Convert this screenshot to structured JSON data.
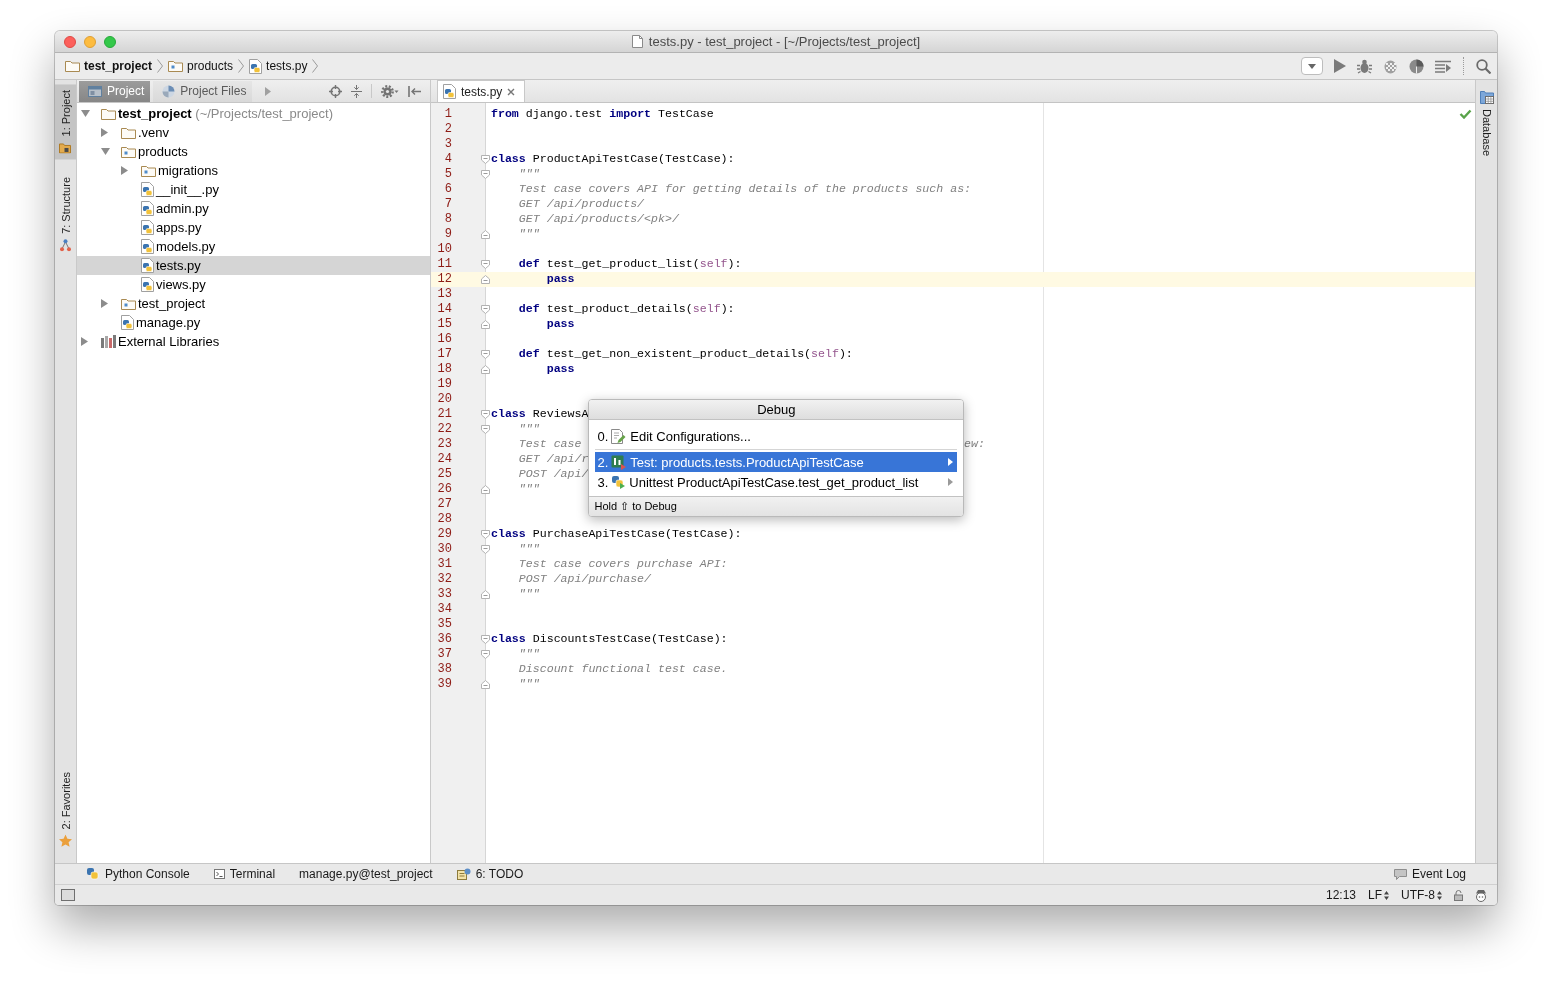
{
  "window": {
    "title": "tests.py - test_project - [~/Projects/test_project]"
  },
  "breadcrumbs": [
    {
      "label": "test_project",
      "kind": "project"
    },
    {
      "label": "products",
      "kind": "module"
    },
    {
      "label": "tests.py",
      "kind": "script"
    }
  ],
  "left_tool_tabs": {
    "top": [
      {
        "label": "1: Project",
        "kind": "project",
        "selected": true
      },
      {
        "label": "7: Structure",
        "kind": "structure",
        "selected": false
      }
    ],
    "bottom": [
      {
        "label": "2: Favorites",
        "kind": "favorites",
        "selected": false
      }
    ]
  },
  "project_panel": {
    "tabs": [
      {
        "label": "Project",
        "kind": "project",
        "selected": true
      },
      {
        "label": "Project Files",
        "kind": "files",
        "selected": false
      }
    ],
    "tree": [
      {
        "label": "test_project",
        "hint": "(~/Projects/test_project)",
        "kind": "project",
        "expanded": true,
        "selected": false,
        "children": [
          {
            "label": ".venv",
            "kind": "folder",
            "expanded": false,
            "selected": false
          },
          {
            "label": "products",
            "kind": "module",
            "expanded": true,
            "selected": false,
            "children": [
              {
                "label": "migrations",
                "kind": "module",
                "expanded": false,
                "selected": false
              },
              {
                "label": "__init__.py",
                "kind": "script",
                "selected": false
              },
              {
                "label": "admin.py",
                "kind": "script",
                "selected": false
              },
              {
                "label": "apps.py",
                "kind": "script",
                "selected": false
              },
              {
                "label": "models.py",
                "kind": "script",
                "selected": false
              },
              {
                "label": "tests.py",
                "kind": "script",
                "selected": true
              },
              {
                "label": "views.py",
                "kind": "script",
                "selected": false
              }
            ]
          },
          {
            "label": "test_project",
            "kind": "module",
            "expanded": false,
            "selected": false
          },
          {
            "label": "manage.py",
            "kind": "script",
            "selected": false
          }
        ]
      },
      {
        "label": "External Libraries",
        "kind": "library",
        "expanded": false,
        "selected": false
      }
    ]
  },
  "editor": {
    "tabs": [
      {
        "label": "tests.py",
        "selected": true
      }
    ],
    "lines": [
      {
        "number": "1",
        "kind": "plain",
        "tokens": [
          {
            "kind": "keyword",
            "text": "from"
          },
          {
            "kind": "plain",
            "text": " django.test "
          },
          {
            "kind": "keyword",
            "text": "import"
          },
          {
            "kind": "plain",
            "text": " TestCase"
          }
        ]
      },
      {
        "number": "2",
        "kind": "plain"
      },
      {
        "number": "3",
        "kind": "plain"
      },
      {
        "number": "4",
        "kind": "opening",
        "tokens": [
          {
            "kind": "keyword",
            "text": "class"
          },
          {
            "kind": "plain",
            "text": " ProductApiTestCase(TestCase):"
          }
        ]
      },
      {
        "number": "5",
        "kind": "opening",
        "tokens": [
          {
            "kind": "docstring",
            "text": "    \"\"\""
          }
        ]
      },
      {
        "number": "6",
        "kind": "plain",
        "tokens": [
          {
            "kind": "docstring",
            "text": "    Test case covers API for getting details of the products such as:"
          }
        ]
      },
      {
        "number": "7",
        "kind": "plain",
        "tokens": [
          {
            "kind": "docstring",
            "text": "    GET /api/products/"
          }
        ]
      },
      {
        "number": "8",
        "kind": "plain",
        "tokens": [
          {
            "kind": "docstring",
            "text": "    GET /api/products/<pk>/"
          }
        ]
      },
      {
        "number": "9",
        "kind": "closing",
        "tokens": [
          {
            "kind": "docstring",
            "text": "    \"\"\""
          }
        ]
      },
      {
        "number": "10",
        "kind": "plain"
      },
      {
        "number": "11",
        "kind": "opening",
        "tokens": [
          {
            "kind": "keyword",
            "text": "    def"
          },
          {
            "kind": "plain",
            "text": " test_get_product_list("
          },
          {
            "kind": "self",
            "text": "self"
          },
          {
            "kind": "plain",
            "text": "):"
          }
        ]
      },
      {
        "number": "12",
        "kind": "closing",
        "current": true,
        "tokens": [
          {
            "kind": "keyword",
            "text": "        pass"
          }
        ]
      },
      {
        "number": "13",
        "kind": "plain"
      },
      {
        "number": "14",
        "kind": "opening",
        "tokens": [
          {
            "kind": "keyword",
            "text": "    def"
          },
          {
            "kind": "plain",
            "text": " test_product_details("
          },
          {
            "kind": "self",
            "text": "self"
          },
          {
            "kind": "plain",
            "text": "):"
          }
        ]
      },
      {
        "number": "15",
        "kind": "closing",
        "tokens": [
          {
            "kind": "keyword",
            "text": "        pass"
          }
        ]
      },
      {
        "number": "16",
        "kind": "plain"
      },
      {
        "number": "17",
        "kind": "opening",
        "tokens": [
          {
            "kind": "keyword",
            "text": "    def"
          },
          {
            "kind": "plain",
            "text": " test_get_non_existent_product_details("
          },
          {
            "kind": "self",
            "text": "self"
          },
          {
            "kind": "plain",
            "text": "):"
          }
        ]
      },
      {
        "number": "18",
        "kind": "closing",
        "tokens": [
          {
            "kind": "keyword",
            "text": "        pass"
          }
        ]
      },
      {
        "number": "19",
        "kind": "plain"
      },
      {
        "number": "20",
        "kind": "plain"
      },
      {
        "number": "21",
        "kind": "opening",
        "tokens": [
          {
            "kind": "keyword",
            "text": "class"
          },
          {
            "kind": "plain",
            "text": " ReviewsA"
          }
        ]
      },
      {
        "number": "22",
        "kind": "opening",
        "tokens": [
          {
            "kind": "docstring",
            "text": "    \"\"\""
          }
        ]
      },
      {
        "number": "23",
        "kind": "plain",
        "tokens": [
          {
            "kind": "docstring",
            "text": "    Test case"
          }
        ],
        "tail": [
          {
            "kind": "docstring",
            "text": "ew:"
          }
        ]
      },
      {
        "number": "24",
        "kind": "plain",
        "tokens": [
          {
            "kind": "docstring",
            "text": "    GET /api/r"
          }
        ]
      },
      {
        "number": "25",
        "kind": "plain",
        "tokens": [
          {
            "kind": "docstring",
            "text": "    POST /api/"
          }
        ]
      },
      {
        "number": "26",
        "kind": "closing",
        "tokens": [
          {
            "kind": "docstring",
            "text": "    \"\"\""
          }
        ]
      },
      {
        "number": "27",
        "kind": "plain"
      },
      {
        "number": "28",
        "kind": "plain"
      },
      {
        "number": "29",
        "kind": "opening",
        "tokens": [
          {
            "kind": "keyword",
            "text": "class"
          },
          {
            "kind": "plain",
            "text": " PurchaseApiTestCase(TestCase):"
          }
        ]
      },
      {
        "number": "30",
        "kind": "opening",
        "tokens": [
          {
            "kind": "docstring",
            "text": "    \"\"\""
          }
        ]
      },
      {
        "number": "31",
        "kind": "plain",
        "tokens": [
          {
            "kind": "docstring",
            "text": "    Test case covers purchase API:"
          }
        ]
      },
      {
        "number": "32",
        "kind": "plain",
        "tokens": [
          {
            "kind": "docstring",
            "text": "    POST /api/purchase/"
          }
        ]
      },
      {
        "number": "33",
        "kind": "closing",
        "tokens": [
          {
            "kind": "docstring",
            "text": "    \"\"\""
          }
        ]
      },
      {
        "number": "34",
        "kind": "plain"
      },
      {
        "number": "35",
        "kind": "plain"
      },
      {
        "number": "36",
        "kind": "opening",
        "tokens": [
          {
            "kind": "keyword",
            "text": "class"
          },
          {
            "kind": "plain",
            "text": " DiscountsTestCase(TestCase):"
          }
        ]
      },
      {
        "number": "37",
        "kind": "opening",
        "tokens": [
          {
            "kind": "docstring",
            "text": "    \"\"\""
          }
        ]
      },
      {
        "number": "38",
        "kind": "plain",
        "tokens": [
          {
            "kind": "docstring",
            "text": "    Discount functional test case."
          }
        ]
      },
      {
        "number": "39",
        "kind": "closing",
        "tokens": [
          {
            "kind": "docstring",
            "text": "    \"\"\""
          }
        ]
      }
    ]
  },
  "debug_popup": {
    "title": "Debug",
    "items": [
      {
        "number": "0.",
        "label": "Edit Configurations...",
        "kind": "edit",
        "selected": false,
        "submenu": false,
        "separator_after": true
      },
      {
        "number": "2.",
        "label": "Test: products.tests.ProductApiTestCase",
        "kind": "test",
        "selected": true,
        "submenu": true,
        "separator_after": false
      },
      {
        "number": "3.",
        "label": "Unittest ProductApiTestCase.test_get_product_list",
        "kind": "unittest",
        "selected": false,
        "submenu": true,
        "separator_after": false
      }
    ],
    "hint": "Hold ⇧ to Debug"
  },
  "right_tool_tabs": [
    {
      "label": "Database",
      "selected": false
    }
  ],
  "bottom_tool_tabs": {
    "left": [
      {
        "label": "Python Console",
        "kind": "console"
      },
      {
        "label": "Terminal",
        "kind": "terminal"
      },
      {
        "label": "manage.py@test_project",
        "kind": "task"
      },
      {
        "label": "6: TODO",
        "kind": "todo"
      }
    ],
    "right": [
      {
        "label": "Event Log",
        "kind": "log"
      }
    ]
  },
  "status_bar": {
    "position": "12:13",
    "line_separator": "LF",
    "encoding": "UTF-8"
  }
}
